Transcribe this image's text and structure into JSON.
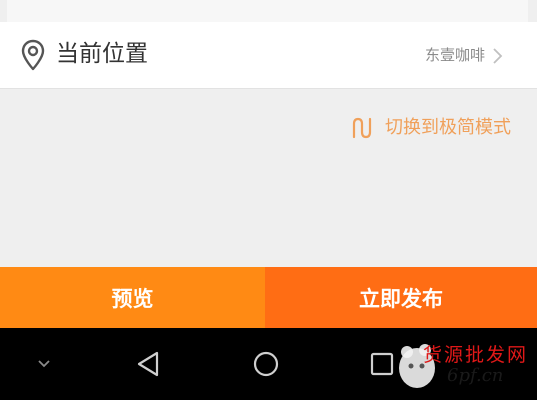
{
  "location": {
    "title": "当前位置",
    "value": "东壹咖啡",
    "icon": "location-pin-icon"
  },
  "mode_switch": {
    "label": "切换到极简模式",
    "icon": "switch-icon",
    "color": "#f0a05a"
  },
  "actions": {
    "preview_label": "预览",
    "publish_label": "立即发布",
    "preview_color": "#ff8a14",
    "publish_color": "#ff6d14"
  },
  "navbar": {
    "icons": [
      "chevron-down-icon",
      "back-icon",
      "home-icon",
      "recents-icon"
    ]
  },
  "watermark": {
    "text": "货源批发网",
    "url": "6pf.cn"
  }
}
